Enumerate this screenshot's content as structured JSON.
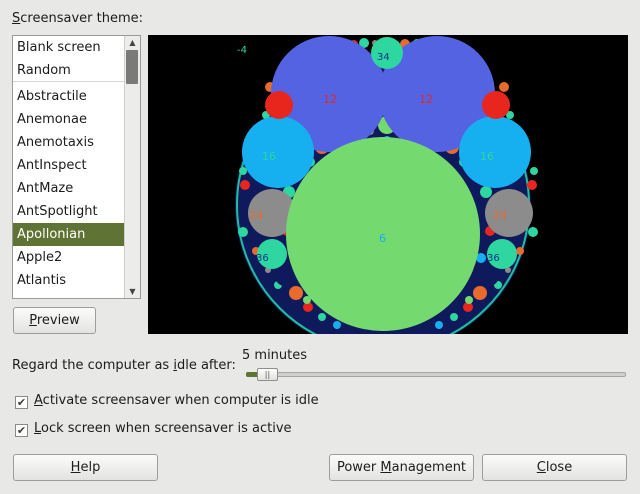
{
  "theme_label": {
    "pre": "",
    "mnemonic": "S",
    "post": "creensaver theme:"
  },
  "themes": [
    "Blank screen",
    "Random",
    "Abstractile",
    "Anemonae",
    "Anemotaxis",
    "AntInspect",
    "AntMaze",
    "AntSpotlight",
    "Apollonian",
    "Apple2",
    "Atlantis"
  ],
  "selected_theme": "Apollonian",
  "preview_button": {
    "mnemonic": "P",
    "post": "review"
  },
  "preview_labels": {
    "corner": "-4",
    "top": "34",
    "left12": "12",
    "right12": "12",
    "left16": "16",
    "right16": "16",
    "left24": "24",
    "right24": "24",
    "center": "6",
    "left36": "36",
    "right36": "36"
  },
  "idle": {
    "label_pre": "Regard the computer as ",
    "label_mnemonic": "i",
    "label_post": "dle after:",
    "value": "5 minutes",
    "slider_fraction": 0.04
  },
  "checkboxes": [
    {
      "mnemonic": "A",
      "post": "ctivate screensaver when computer is idle",
      "checked": true
    },
    {
      "mnemonic": "L",
      "post": "ock screen when screensaver is active",
      "checked": true
    }
  ],
  "buttons": {
    "help": {
      "mnemonic": "H",
      "post": "elp"
    },
    "power": {
      "pre": "Power ",
      "mnemonic": "M",
      "post": "anagement"
    },
    "close": {
      "mnemonic": "C",
      "post": "lose"
    }
  },
  "colors": {
    "selection": "#5e7334",
    "big_circle": "#74d96f",
    "blue": "#5463e2",
    "cyan": "#16b0f0",
    "gray": "#8c8c8c",
    "red": "#e8261d",
    "mint": "#2ed6a0"
  },
  "icons": {
    "check": "✔",
    "scroll_up": "▲",
    "scroll_down": "▼",
    "slider_grip": "||"
  }
}
